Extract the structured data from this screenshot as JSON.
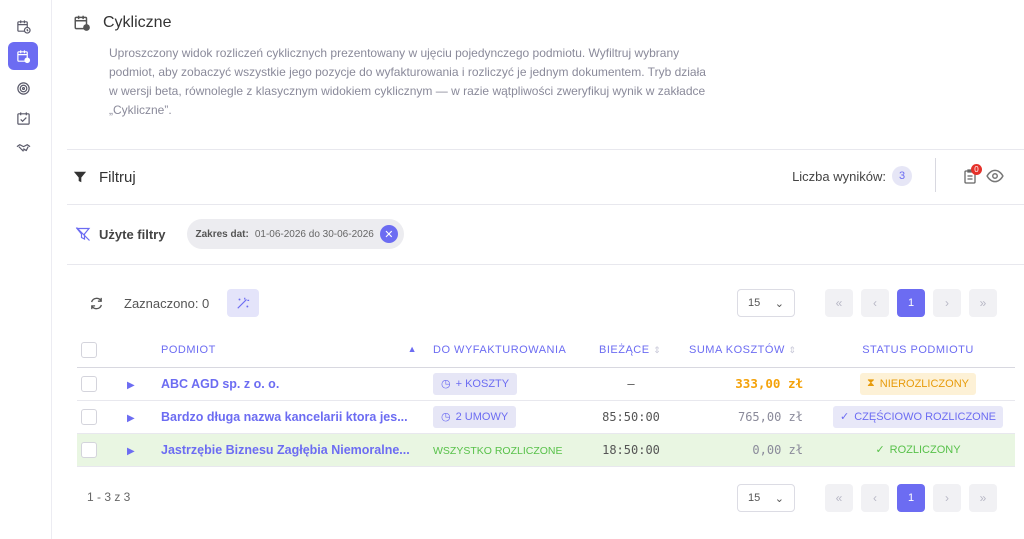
{
  "sidebar": {
    "items": [
      {
        "icon": "calendar-clock-icon",
        "active": false
      },
      {
        "icon": "calendar-recurring-icon",
        "active": true
      },
      {
        "icon": "target-icon",
        "active": false
      },
      {
        "icon": "calendar-check-icon",
        "active": false
      },
      {
        "icon": "handshake-icon",
        "active": false
      }
    ]
  },
  "header": {
    "title": "Cykliczne",
    "description": "Uproszczony widok rozliczeń cyklicznych prezentowany w ujęciu pojedynczego podmiotu. Wyfiltruj wybrany podmiot, aby zobaczyć wszystkie jego pozycje do wyfakturowania i rozliczyć je jednym dokumentem. Tryb działa w wersji beta, równolegle z klasycznym widokiem cyklicznym — w razie wątpliwości zweryfikuj wynik w zakładce „Cykliczne”."
  },
  "filter_bar": {
    "label": "Filtruj",
    "results_label": "Liczba wyników:",
    "results_count": "3",
    "notification_count": "0"
  },
  "used_filters": {
    "label": "Użyte filtry",
    "chip_key": "Zakres dat:",
    "chip_value": "01-06-2026 do 30-06-2026"
  },
  "toolbar": {
    "selected_label": "Zaznaczono: 0"
  },
  "pagination": {
    "page_size": "15",
    "current_page": "1",
    "range_text": "1 - 3 z 3"
  },
  "table": {
    "headers": {
      "entity": "PODMIOT",
      "to_invoice": "DO WYFAKTUROWANIA",
      "current": "BIEŻĄCE",
      "cost_sum": "SUMA KOSZTÓW",
      "status": "STATUS PODMIOTU"
    },
    "rows": [
      {
        "entity": "ABC AGD sp. z o. o.",
        "to_invoice": "+ KOSZTY",
        "current": "—",
        "cost_sum": "333,00 zł",
        "status": "NIEROZLICZONY"
      },
      {
        "entity": "Bardzo długa nazwa kancelarii ktora jes...",
        "to_invoice": "2 UMOWY",
        "current": "85:50:00",
        "cost_sum": "765,00 zł",
        "status": "CZĘŚCIOWO ROZLICZONE"
      },
      {
        "entity": "Jastrzębie Biznesu Zagłębia Niemoralne...",
        "to_invoice": "WSZYSTKO ROZLICZONE",
        "current": "18:50:00",
        "cost_sum": "0,00 zł",
        "status": "ROZLICZONY"
      }
    ]
  },
  "colors": {
    "accent": "#6c6cf2",
    "warning": "#f4a20a",
    "success": "#58c14a",
    "danger": "#e5312a"
  }
}
